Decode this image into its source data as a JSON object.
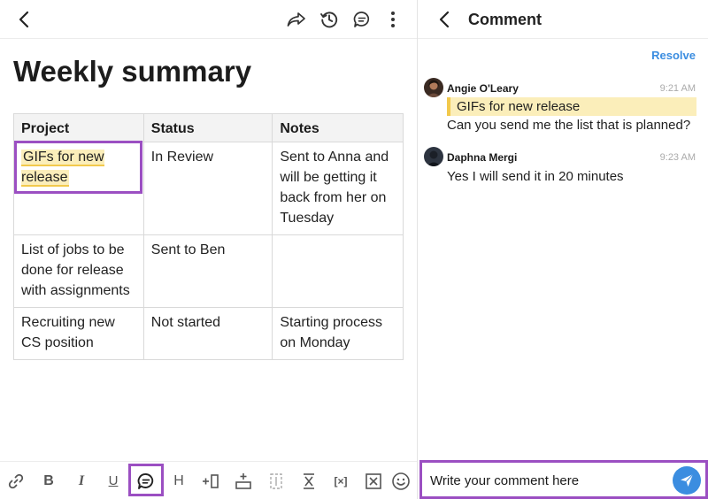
{
  "document": {
    "title": "Weekly summary",
    "table": {
      "headers": [
        "Project",
        "Status",
        "Notes"
      ],
      "rows": [
        [
          "GIFs for new release",
          "In Review",
          "Sent to Anna and will be getting it back from her on Tuesday"
        ],
        [
          "List of jobs to be done for release with assignments",
          "Sent to Ben",
          ""
        ],
        [
          "Recruiting new CS position",
          "Not started",
          "Starting process on Monday"
        ]
      ]
    },
    "toolbar": {
      "bold": "B",
      "italic": "I",
      "underline": "U",
      "heading": "H",
      "clear_format": "[×]"
    }
  },
  "comments_panel": {
    "title": "Comment",
    "resolve_label": "Resolve",
    "comments": [
      {
        "author": "Angie O'Leary",
        "time": "9:21 AM",
        "quote": "GIFs for new release",
        "text": "Can you send me the list that is planned?"
      },
      {
        "author": "Daphna Mergi",
        "time": "9:23 AM",
        "text": "Yes I will send it in 20 minutes"
      }
    ],
    "input_value": "Write your comment here"
  },
  "colors": {
    "accent_blue": "#3b8de0",
    "highlight_yellow": "#fbeeba",
    "highlight_border": "#f2c94c",
    "selection_purple": "#9b4fc2"
  }
}
